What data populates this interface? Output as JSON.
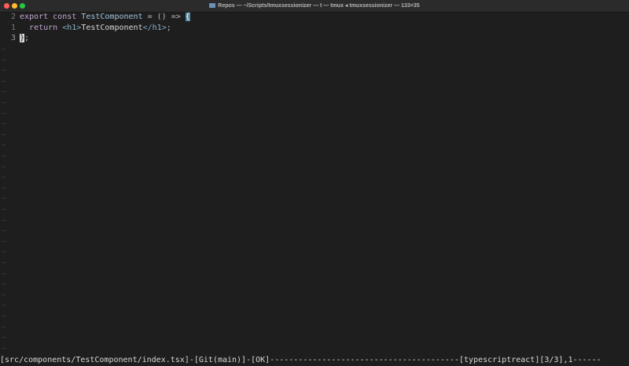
{
  "window": {
    "title": "Repos — ~/Scripts/tmuxsessionizer — t — tmux ◂ tmuxsessionizer — 133×35",
    "folder_icon": "folder-icon"
  },
  "editor": {
    "lines": [
      {
        "number": "2",
        "kw1": "export",
        "kw2": "const",
        "name": "TestComponent",
        "rest": " = () => ",
        "brace": "{"
      },
      {
        "number": "1",
        "indent": "  ",
        "kw": "return",
        "open_lt": "<",
        "open_tag": "h1",
        "open_gt": ">",
        "text": "TestComponent",
        "close_lt": "</",
        "close_tag": "h1",
        "close_gt": ">",
        "semi": ";"
      },
      {
        "number": "3",
        "brace": "}",
        "semi": ";"
      }
    ],
    "filler": "~"
  },
  "statusline": {
    "text": "[src/components/TestComponent/index.tsx]-[Git(main)]-[OK]----------------------------------------[typescriptreact][3/3],1------"
  },
  "colors": {
    "background": "#1e1e1e",
    "keyword": "#c0a5cf",
    "identifier": "#9fc3dc",
    "tag": "#7aa9c9",
    "bracket_match": "#5a8aa0"
  }
}
